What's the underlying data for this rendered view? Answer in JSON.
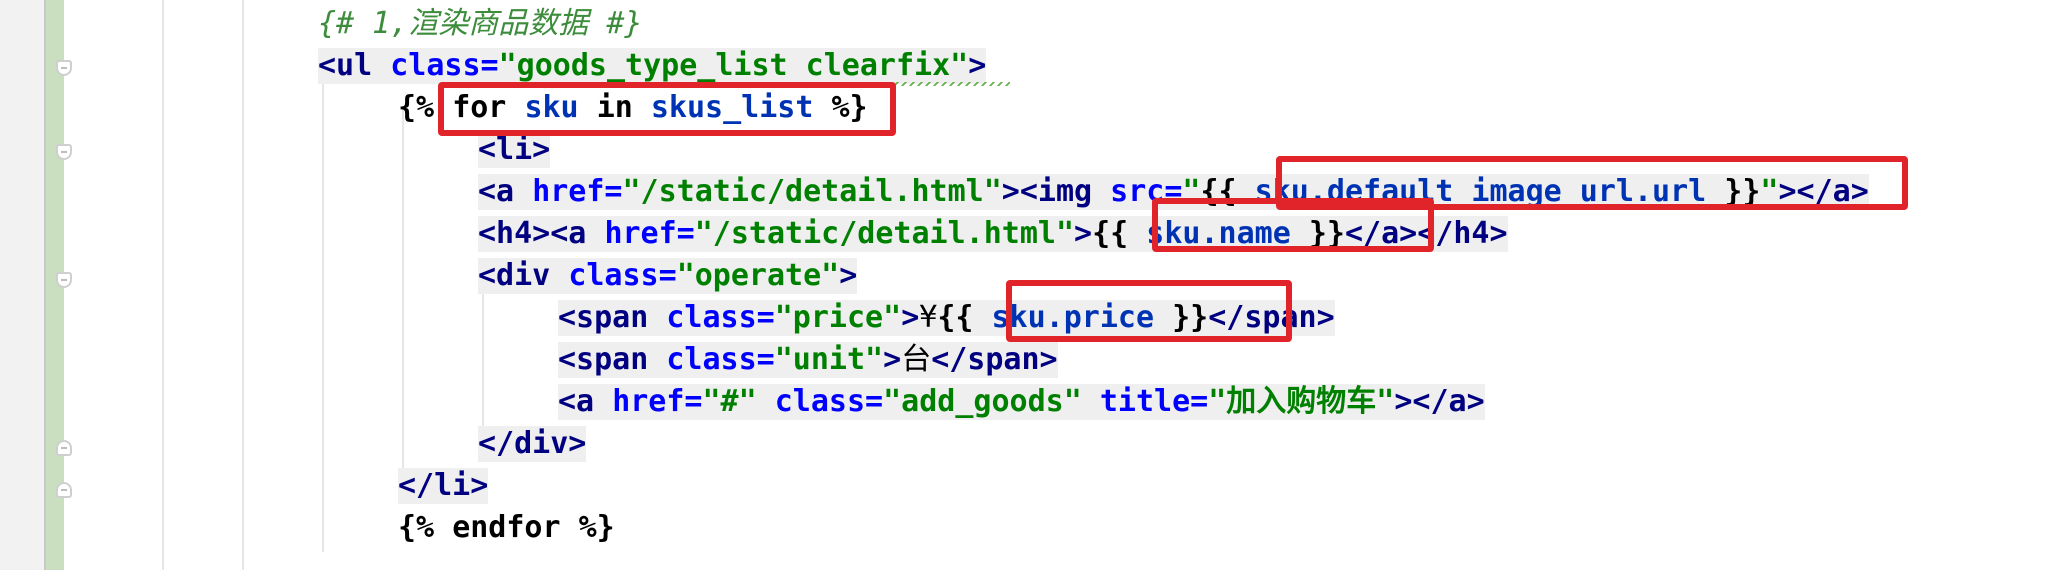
{
  "editor": {
    "lines": [
      {
        "id": "l1",
        "segments": [
          {
            "t": "{# 1,渲染商品数据 #}",
            "c": "comment"
          }
        ]
      },
      {
        "id": "l2",
        "segments": [
          {
            "t": "<ul ",
            "c": "tag"
          },
          {
            "t": "class=",
            "c": "attr"
          },
          {
            "t": "\"goods_type_list clearfix\"",
            "c": "str"
          },
          {
            "t": ">",
            "c": "tag"
          }
        ]
      },
      {
        "id": "l3",
        "segments": [
          {
            "t": "{% ",
            "c": "tpl"
          },
          {
            "t": "for ",
            "c": "tpl"
          },
          {
            "t": "sku ",
            "c": "var"
          },
          {
            "t": "in ",
            "c": "tpl"
          },
          {
            "t": "skus_list ",
            "c": "var"
          },
          {
            "t": "%}",
            "c": "tpl"
          }
        ]
      },
      {
        "id": "l4",
        "segments": [
          {
            "t": "<li>",
            "c": "tag"
          }
        ]
      },
      {
        "id": "l5",
        "segments": [
          {
            "t": "<a ",
            "c": "tag"
          },
          {
            "t": "href=",
            "c": "attr"
          },
          {
            "t": "\"/static/detail.html\"",
            "c": "str"
          },
          {
            "t": "><img ",
            "c": "tag"
          },
          {
            "t": "src=",
            "c": "attr"
          },
          {
            "t": "\"",
            "c": "str"
          },
          {
            "t": "{{ ",
            "c": "tpl"
          },
          {
            "t": "sku.default_image_url.url ",
            "c": "var"
          },
          {
            "t": "}}",
            "c": "tpl"
          },
          {
            "t": "\"",
            "c": "str"
          },
          {
            "t": "></a>",
            "c": "tag"
          }
        ]
      },
      {
        "id": "l6",
        "segments": [
          {
            "t": "<h4><a ",
            "c": "tag"
          },
          {
            "t": "href=",
            "c": "attr"
          },
          {
            "t": "\"/static/detail.html\"",
            "c": "str"
          },
          {
            "t": ">",
            "c": "tag"
          },
          {
            "t": "{{ ",
            "c": "tpl"
          },
          {
            "t": "sku.name ",
            "c": "var"
          },
          {
            "t": "}}",
            "c": "tpl"
          },
          {
            "t": "</a></h4>",
            "c": "tag"
          }
        ]
      },
      {
        "id": "l7",
        "segments": [
          {
            "t": "<div ",
            "c": "tag"
          },
          {
            "t": "class=",
            "c": "attr"
          },
          {
            "t": "\"operate\"",
            "c": "str"
          },
          {
            "t": ">",
            "c": "tag"
          }
        ]
      },
      {
        "id": "l8",
        "segments": [
          {
            "t": "<span ",
            "c": "tag"
          },
          {
            "t": "class=",
            "c": "attr"
          },
          {
            "t": "\"price\"",
            "c": "str"
          },
          {
            "t": ">",
            "c": "tag"
          },
          {
            "t": "¥",
            "c": "punct"
          },
          {
            "t": "{{ ",
            "c": "tpl"
          },
          {
            "t": "sku.price ",
            "c": "var"
          },
          {
            "t": "}}",
            "c": "tpl"
          },
          {
            "t": "</span>",
            "c": "tag"
          }
        ]
      },
      {
        "id": "l9",
        "segments": [
          {
            "t": "<span ",
            "c": "tag"
          },
          {
            "t": "class=",
            "c": "attr"
          },
          {
            "t": "\"unit\"",
            "c": "str"
          },
          {
            "t": ">",
            "c": "tag"
          },
          {
            "t": "台",
            "c": "punct"
          },
          {
            "t": "</span>",
            "c": "tag"
          }
        ]
      },
      {
        "id": "l10",
        "segments": [
          {
            "t": "<a ",
            "c": "tag"
          },
          {
            "t": "href=",
            "c": "attr"
          },
          {
            "t": "\"#\" ",
            "c": "str"
          },
          {
            "t": "class=",
            "c": "attr"
          },
          {
            "t": "\"add_goods\" ",
            "c": "str"
          },
          {
            "t": "title=",
            "c": "attr"
          },
          {
            "t": "\"加入购物车\"",
            "c": "str"
          },
          {
            "t": "></a>",
            "c": "tag"
          }
        ]
      },
      {
        "id": "l11",
        "segments": [
          {
            "t": "</div>",
            "c": "tag"
          }
        ]
      },
      {
        "id": "l12",
        "segments": [
          {
            "t": "</li>",
            "c": "tag"
          }
        ]
      },
      {
        "id": "l13",
        "segments": [
          {
            "t": "{% ",
            "c": "tpl"
          },
          {
            "t": "endfor ",
            "c": "tpl"
          },
          {
            "t": "%}",
            "c": "tpl"
          }
        ]
      }
    ]
  },
  "colors": {
    "highlight_box": "#e0242a",
    "string": "#008000",
    "tag": "#000080",
    "attribute": "#0000ff",
    "comment": "#3c8c3c"
  }
}
